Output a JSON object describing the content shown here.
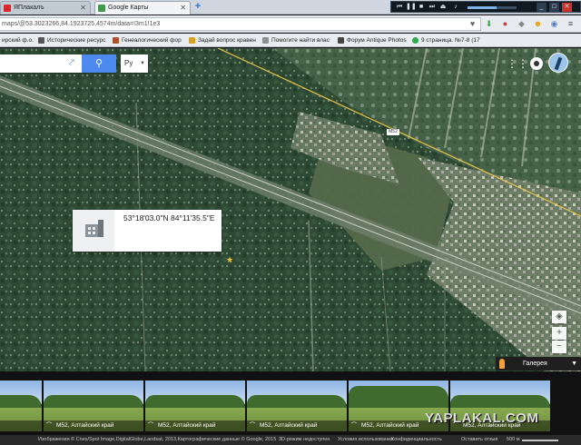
{
  "tabs": [
    {
      "title": "ЯПлакалъ",
      "favicon_color": "#d9262d"
    },
    {
      "title": "Google Карты",
      "favicon_color": "#3f9a4c"
    }
  ],
  "new_tab_label": "+",
  "player": {
    "progress": 0.6
  },
  "address": {
    "url": "maps/@53.3023266,84.1923725,4574m/data=!3m1!1e3"
  },
  "bookmarks": [
    {
      "label": "ирский ф.о.",
      "color": "#c63b2f"
    },
    {
      "label": "Исторические ресурс",
      "color": "#555555"
    },
    {
      "label": "Генеалогический фор",
      "color": "#a9552b"
    },
    {
      "label": "Задай вопрос кравен",
      "color": "#d6a12a"
    },
    {
      "label": "Помогите найти влас",
      "color": "#8f8f8f"
    },
    {
      "label": "Форум Antique Photos",
      "color": "#444444"
    },
    {
      "label": "9 страница. №7-8 (17",
      "color": "#2eaa4f"
    }
  ],
  "search": {
    "value": "",
    "lang": "Ру"
  },
  "road_label": "М52",
  "card": {
    "coordinates": "53°18'03.0\"N 84°11'35.5\"E"
  },
  "zoom": {
    "in": "+",
    "out": "−"
  },
  "gallery": {
    "label": "Галерея"
  },
  "photos": [
    {
      "caption": ""
    },
    {
      "caption": "М52, Алтайский край"
    },
    {
      "caption": "М52, Алтайский край"
    },
    {
      "caption": "М52, Алтайский край"
    },
    {
      "caption": "М52, Алтайский край"
    },
    {
      "caption": "М52, Алтайский край"
    }
  ],
  "watermark": "YAPLAKAL.COM",
  "footer": [
    "Изображения © Cnes/Spot Image,DigitalGlobe,Landsat, 2013,Картографические данные © Google, 2015",
    "3D-режим недоступен",
    "Условия использования",
    "Конфиденциальность",
    "Оставить отзыв",
    "500 м"
  ]
}
